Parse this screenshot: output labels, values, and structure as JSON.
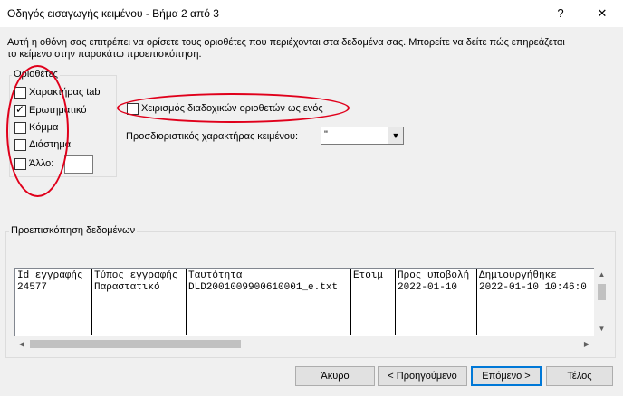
{
  "window": {
    "title": "Οδηγός εισαγωγής κειμένου - Βήμα 2 από 3",
    "help_label": "?",
    "close_label": "✕"
  },
  "description": {
    "line1": "Αυτή η οθόνη σας επιτρέπει να ορίσετε τους οριοθέτες που περιέχονται στα δεδομένα σας.  Μπορείτε να δείτε πώς επηρεάζεται",
    "line2": "το κείμενο στην παρακάτω προεπισκόπηση."
  },
  "delimiters": {
    "legend": "Οριοθέτες",
    "options": [
      {
        "label": "Χαρακτήρας tab",
        "checked": false
      },
      {
        "label": "Ερωτηματικό",
        "checked": true
      },
      {
        "label": "Κόμμα",
        "checked": false
      },
      {
        "label": "Διάστημα",
        "checked": false
      },
      {
        "label": "Άλλο:",
        "checked": false
      }
    ],
    "other_value": ""
  },
  "consecutive": {
    "label": "Χειρισμός διαδοχικών οριοθετών ως ενός",
    "checked": false
  },
  "qualifier": {
    "label": "Προσδιοριστικός χαρακτήρας κειμένου:",
    "value": "\""
  },
  "preview": {
    "legend": "Προεπισκόπηση δεδομένων",
    "columns": [
      {
        "header": "Id εγγραφής",
        "value": "24577"
      },
      {
        "header": "Τύπος εγγραφής",
        "value": "Παραστατικό"
      },
      {
        "header": "Ταυτότητα",
        "value": "DLD2001009900610001_e.txt"
      },
      {
        "header": "Ετοιμ",
        "value": ""
      },
      {
        "header": "Προς υποβολή",
        "value": "2022-01-10"
      },
      {
        "header": "Δημιουργήθηκε",
        "value": "2022-01-10 10:46:0"
      }
    ]
  },
  "buttons": {
    "cancel": "Άκυρο",
    "back": "< Προηγούμενο",
    "next": "Επόμενο >",
    "finish": "Τέλος"
  },
  "annotation_color": "#e0001b"
}
